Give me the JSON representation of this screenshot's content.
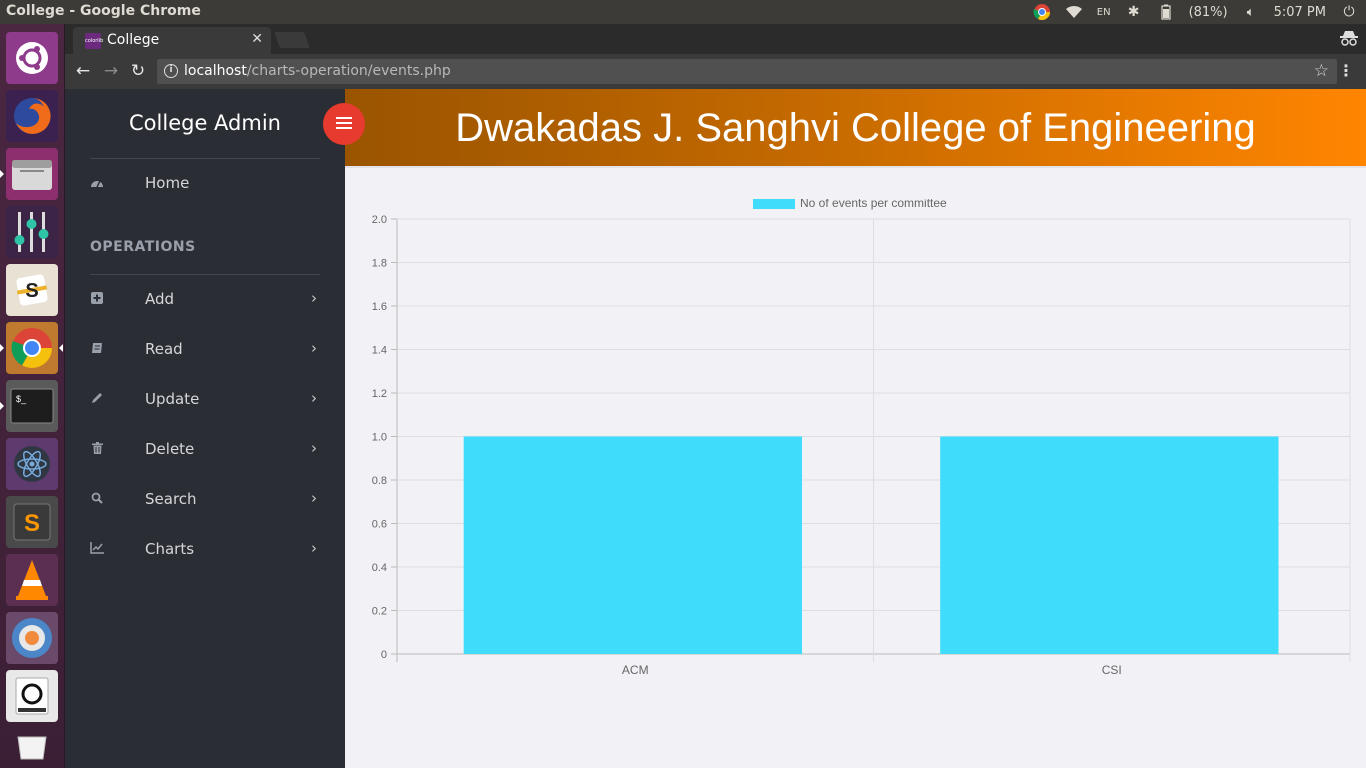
{
  "os": {
    "window_title": "College - Google Chrome",
    "battery": "(81%)",
    "clock": "5:07 PM",
    "keyboard": "EN",
    "launcher_icons": [
      "ubuntu-dash-icon",
      "firefox-icon",
      "files-icon",
      "mixer-icon",
      "slack-icon",
      "chrome-icon",
      "terminal-icon",
      "atom-icon",
      "sublime-icon",
      "vlc-icon",
      "software-updater-icon",
      "disk-icon",
      "trash-icon"
    ]
  },
  "browser": {
    "tab_title": "College",
    "favicon_text": "colorlib",
    "url_host": "localhost",
    "url_path": "/charts-operation/events.php"
  },
  "sidebar": {
    "brand": "College Admin",
    "home": "Home",
    "section_heading": "OPERATIONS",
    "items": [
      {
        "label": "Add",
        "icon": "plus-square-icon"
      },
      {
        "label": "Read",
        "icon": "book-icon"
      },
      {
        "label": "Update",
        "icon": "pencil-icon"
      },
      {
        "label": "Delete",
        "icon": "trash-icon"
      },
      {
        "label": "Search",
        "icon": "search-icon"
      },
      {
        "label": "Charts",
        "icon": "line-chart-icon"
      }
    ]
  },
  "header": {
    "college_name": "Dwakadas J. Sanghvi College of Engineering"
  },
  "colors": {
    "bar": "#3fdcfb",
    "header_start": "#9a5400",
    "header_end": "#ff8500",
    "toggle": "#e63b2e"
  },
  "chart_data": {
    "type": "bar",
    "categories": [
      "ACM",
      "CSI"
    ],
    "series": [
      {
        "name": "No of events per committee",
        "values": [
          1,
          1
        ]
      }
    ],
    "ylim": [
      0,
      2.0
    ],
    "yticks": [
      "0",
      "0.2",
      "0.4",
      "0.6",
      "0.8",
      "1.0",
      "1.2",
      "1.4",
      "1.6",
      "1.8",
      "2.0"
    ],
    "legend": "top-center",
    "grid": true
  }
}
